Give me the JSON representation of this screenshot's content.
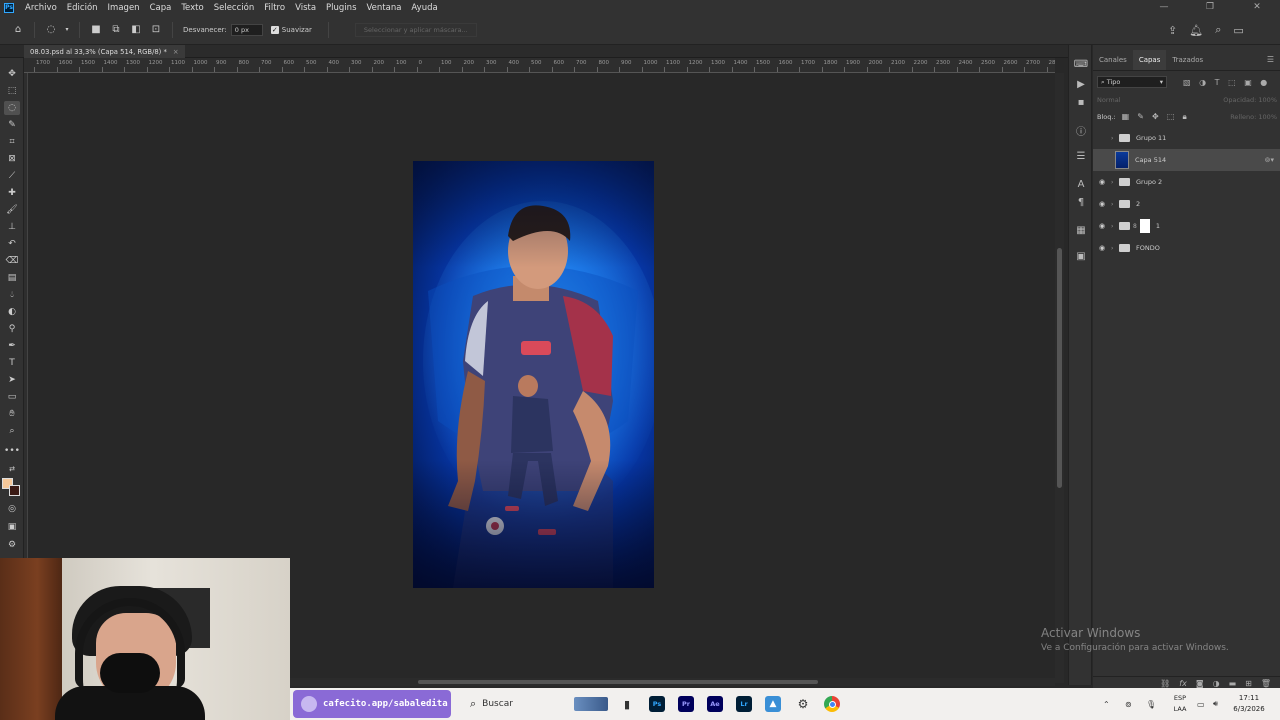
{
  "menubar": {
    "items": [
      "Archivo",
      "Edición",
      "Imagen",
      "Capa",
      "Texto",
      "Selección",
      "Filtro",
      "Vista",
      "Plugins",
      "Ventana",
      "Ayuda"
    ],
    "app_logo": "Ps"
  },
  "options": {
    "feather_label": "Desvanecer:",
    "feather_value": "0 px",
    "antialias_label": "Suavizar",
    "select_mask_label": "Seleccionar y aplicar máscara..."
  },
  "document": {
    "tab_title": "08.03.psd al 33,3% (Capa 514, RGB/8) *"
  },
  "ruler": {
    "labels": [
      "1700",
      "1600",
      "1500",
      "1400",
      "1300",
      "1200",
      "1100",
      "1000",
      "900",
      "800",
      "700",
      "600",
      "500",
      "400",
      "300",
      "200",
      "100",
      "0",
      "100",
      "200",
      "300",
      "400",
      "500",
      "600",
      "700",
      "800",
      "900",
      "1000",
      "1100",
      "1200",
      "1300",
      "1400",
      "1500",
      "1600",
      "1700",
      "1800",
      "1900",
      "2000",
      "2100",
      "2200",
      "2300",
      "2400",
      "2500",
      "2600",
      "2700",
      "2800"
    ]
  },
  "panel": {
    "tabs": [
      "Canales",
      "Capas",
      "Trazados"
    ],
    "active_tab": "Capas",
    "filter_label": "Tipo",
    "blend_mode": "Normal",
    "opacity_label": "Opacidad:",
    "opacity_value": "100%",
    "lock_label": "Bloq.:",
    "fill_label": "Relleno:",
    "fill_value": "100%",
    "layers": [
      {
        "name": "Grupo 11",
        "type": "group",
        "visible": false
      },
      {
        "name": "Capa 514",
        "type": "layer",
        "visible": false,
        "selected": true
      },
      {
        "name": "Grupo 2",
        "type": "group",
        "visible": true
      },
      {
        "name": "2",
        "type": "group",
        "visible": true
      },
      {
        "name": "1",
        "type": "group-mask",
        "visible": true
      },
      {
        "name": "FONDO",
        "type": "group",
        "visible": true
      }
    ]
  },
  "watermark": {
    "line1": "Activar Windows",
    "line2": "Ve a Configuración para activar Windows."
  },
  "taskbar": {
    "cafecito_text": "cafecito.app/sabaledita",
    "search_placeholder": "Buscar",
    "apps": [
      "Ps",
      "Pr",
      "Ae",
      "Lr"
    ],
    "lang_top": "ESP",
    "lang_bottom": "LAA",
    "time": "17:11",
    "date": "6/3/2026"
  },
  "colors": {
    "foreground": "#f5c89a",
    "background": "#3a1a14",
    "accent": "#31a8ff"
  }
}
